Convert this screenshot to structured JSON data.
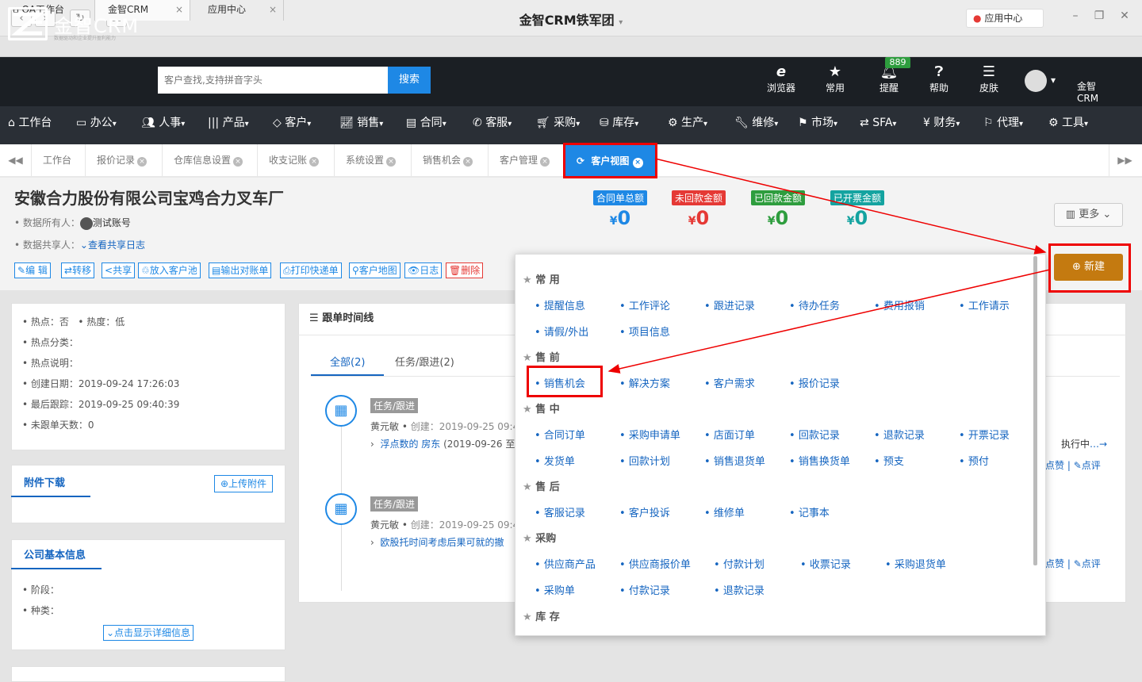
{
  "window": {
    "title": "金智CRM铁军团",
    "app_center": "应用中心"
  },
  "browser_tabs": [
    {
      "label": "OA工作台",
      "icon": "home-icon"
    },
    {
      "label": "金智CRM"
    },
    {
      "label": "应用中心"
    }
  ],
  "logo": {
    "text": "金智CRM",
    "tagline": "数据驱动和企业提升盈利能力"
  },
  "search": {
    "placeholder": "客户查找,支持拼音字头",
    "button": "搜索"
  },
  "header_icons": [
    {
      "label": "浏览器",
      "icon": "ie-browser-icon"
    },
    {
      "label": "常用",
      "icon": "star-icon"
    },
    {
      "label": "提醒",
      "icon": "bell-icon",
      "badge": "889"
    },
    {
      "label": "帮助",
      "icon": "help-icon"
    },
    {
      "label": "皮肤",
      "icon": "skin-icon"
    }
  ],
  "user": {
    "name": "金智CRM—于颖"
  },
  "menu": [
    "工作台",
    "办公",
    "人事",
    "产品",
    "客户",
    "销售",
    "合同",
    "客服",
    "采购",
    "库存",
    "生产",
    "维修",
    "市场",
    "SFA",
    "财务",
    "代理",
    "工具"
  ],
  "page_tabs": [
    "工作台",
    "报价记录",
    "仓库信息设置",
    "收支记账",
    "系统设置",
    "销售机会",
    "客户管理"
  ],
  "active_tab": "客户视图",
  "company": {
    "name": "安徽合力股份有限公司宝鸡合力叉车厂",
    "owner_label": "数据所有人：",
    "owner": "测试账号",
    "share_label": "数据共享人：",
    "share_link": "查看共享日志"
  },
  "kpis": [
    {
      "label": "合同单总额",
      "value": "0",
      "color": "#1e88e5"
    },
    {
      "label": "未回款金额",
      "value": "0",
      "color": "#e53935"
    },
    {
      "label": "已回款金额",
      "value": "0",
      "color": "#2e9d3e"
    },
    {
      "label": "已开票金额",
      "value": "0",
      "color": "#14a3a0"
    }
  ],
  "currency": "¥",
  "more_button": "更多",
  "new_button": "新建",
  "actions": [
    "编 辑",
    "转移",
    "共享",
    "放入客户池",
    "输出对账单",
    "打印快递单",
    "客户地图",
    "日志",
    "删除"
  ],
  "info": [
    "热点：否",
    "热度：低",
    "热点分类：",
    "热点说明：",
    "创建日期：2019-09-24 17:26:03",
    "最后跟踪：2019-09-25 09:40:39",
    "未跟单天数：0"
  ],
  "attachments": {
    "title": "附件下载",
    "upload": "上传附件"
  },
  "basic": {
    "title": "公司基本信息",
    "stage": "阶段：",
    "type": "种类：",
    "toggle": "点击显示详细信息"
  },
  "timeline": {
    "title": "跟单时间线",
    "tab_all": "全部(2)",
    "tab_task": "任务/跟进(2)",
    "items": [
      {
        "tag": "任务/跟进",
        "person": "黄元敏",
        "created": "创建：2019-09-25 09:4",
        "detail": "浮点数的 房东",
        "extra": "(2019-09-26 至"
      },
      {
        "tag": "任务/跟进",
        "person": "黄元敏",
        "created": "创建：2019-09-25 09:4",
        "detail": "欧股托时间考虑后果可就的撤"
      }
    ],
    "status": "执行中",
    "like": "点赞",
    "comment": "点评"
  },
  "popup": {
    "sections": [
      {
        "title": "常 用",
        "items": [
          "提醒信息",
          "工作评论",
          "跟进记录",
          "待办任务",
          "费用报销",
          "工作请示",
          "请假/外出",
          "项目信息"
        ]
      },
      {
        "title": "售 前",
        "items": [
          "销售机会",
          "解决方案",
          "客户需求",
          "报价记录"
        ]
      },
      {
        "title": "售 中",
        "items": [
          "合同订单",
          "采购申请单",
          "店面订单",
          "回款记录",
          "退款记录",
          "开票记录",
          "发货单",
          "回款计划",
          "销售退货单",
          "销售换货单",
          "预支",
          "预付"
        ]
      },
      {
        "title": "售 后",
        "items": [
          "客服记录",
          "客户投诉",
          "维修单",
          "记事本"
        ]
      },
      {
        "title": "采购",
        "items": [
          "供应商产品",
          "供应商报价单",
          "付款计划",
          "收票记录",
          "采购退货单",
          "采购单",
          "付款记录",
          "退款记录"
        ]
      },
      {
        "title": "库 存",
        "items": []
      }
    ]
  }
}
